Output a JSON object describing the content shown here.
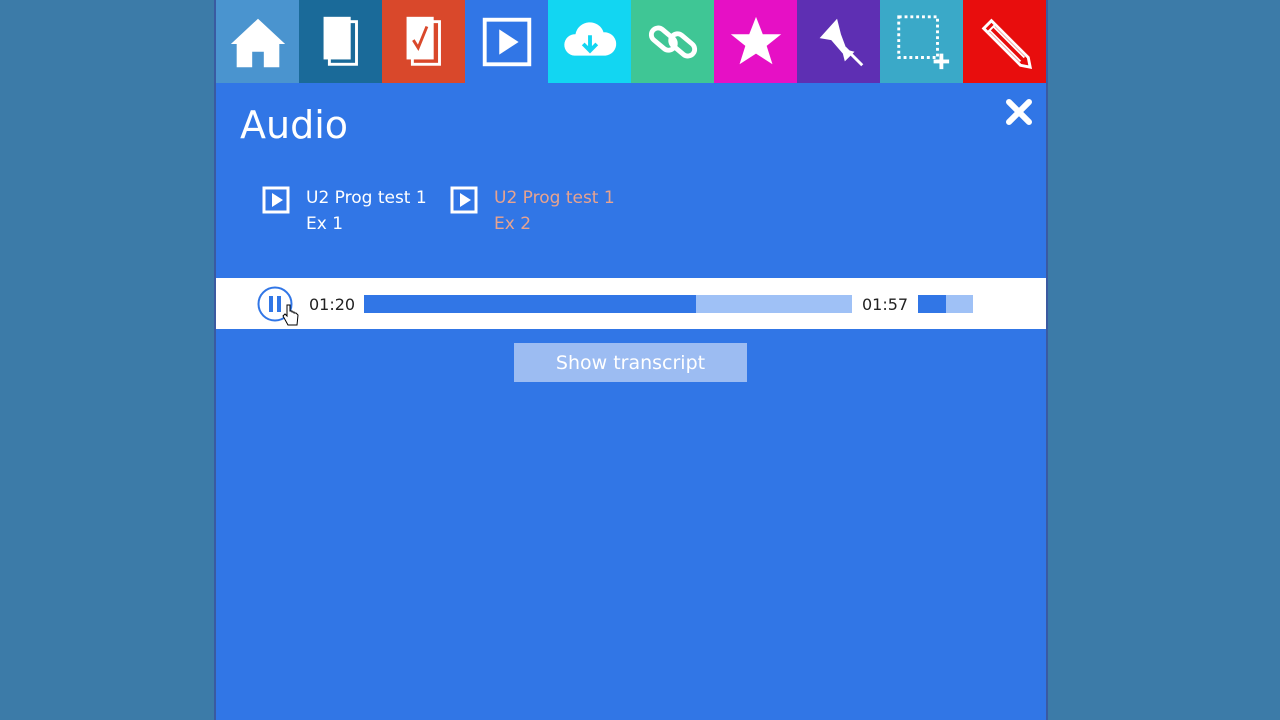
{
  "toolbar": {
    "items": [
      {
        "name": "home-icon",
        "color": "#4a94cf"
      },
      {
        "name": "book-icon",
        "color": "#1a6a99"
      },
      {
        "name": "homework-icon",
        "color": "#d9482b"
      },
      {
        "name": "video-icon",
        "color": "#3176e6"
      },
      {
        "name": "download-icon",
        "color": "#12d6f2"
      },
      {
        "name": "link-icon",
        "color": "#3fc695"
      },
      {
        "name": "star-icon",
        "color": "#e610c5"
      },
      {
        "name": "pin-icon",
        "color": "#5e2fb3"
      },
      {
        "name": "selection-add-icon",
        "color": "#3aa9c8"
      },
      {
        "name": "pencil-icon",
        "color": "#e80d0d"
      }
    ]
  },
  "panel": {
    "title": "Audio",
    "background": "#3176e6"
  },
  "tracks": [
    {
      "line1": "U2 Prog test 1",
      "line2": "Ex 1",
      "state": "normal"
    },
    {
      "line1": "U2 Prog test 1",
      "line2": "Ex 2",
      "state": "active",
      "color": "#e8a38f"
    }
  ],
  "player": {
    "current_time": "01:20",
    "duration": "01:57",
    "progress_fraction": 0.68,
    "volume_fraction": 0.5,
    "state": "playing"
  },
  "transcript_button": {
    "label": "Show transcript"
  }
}
